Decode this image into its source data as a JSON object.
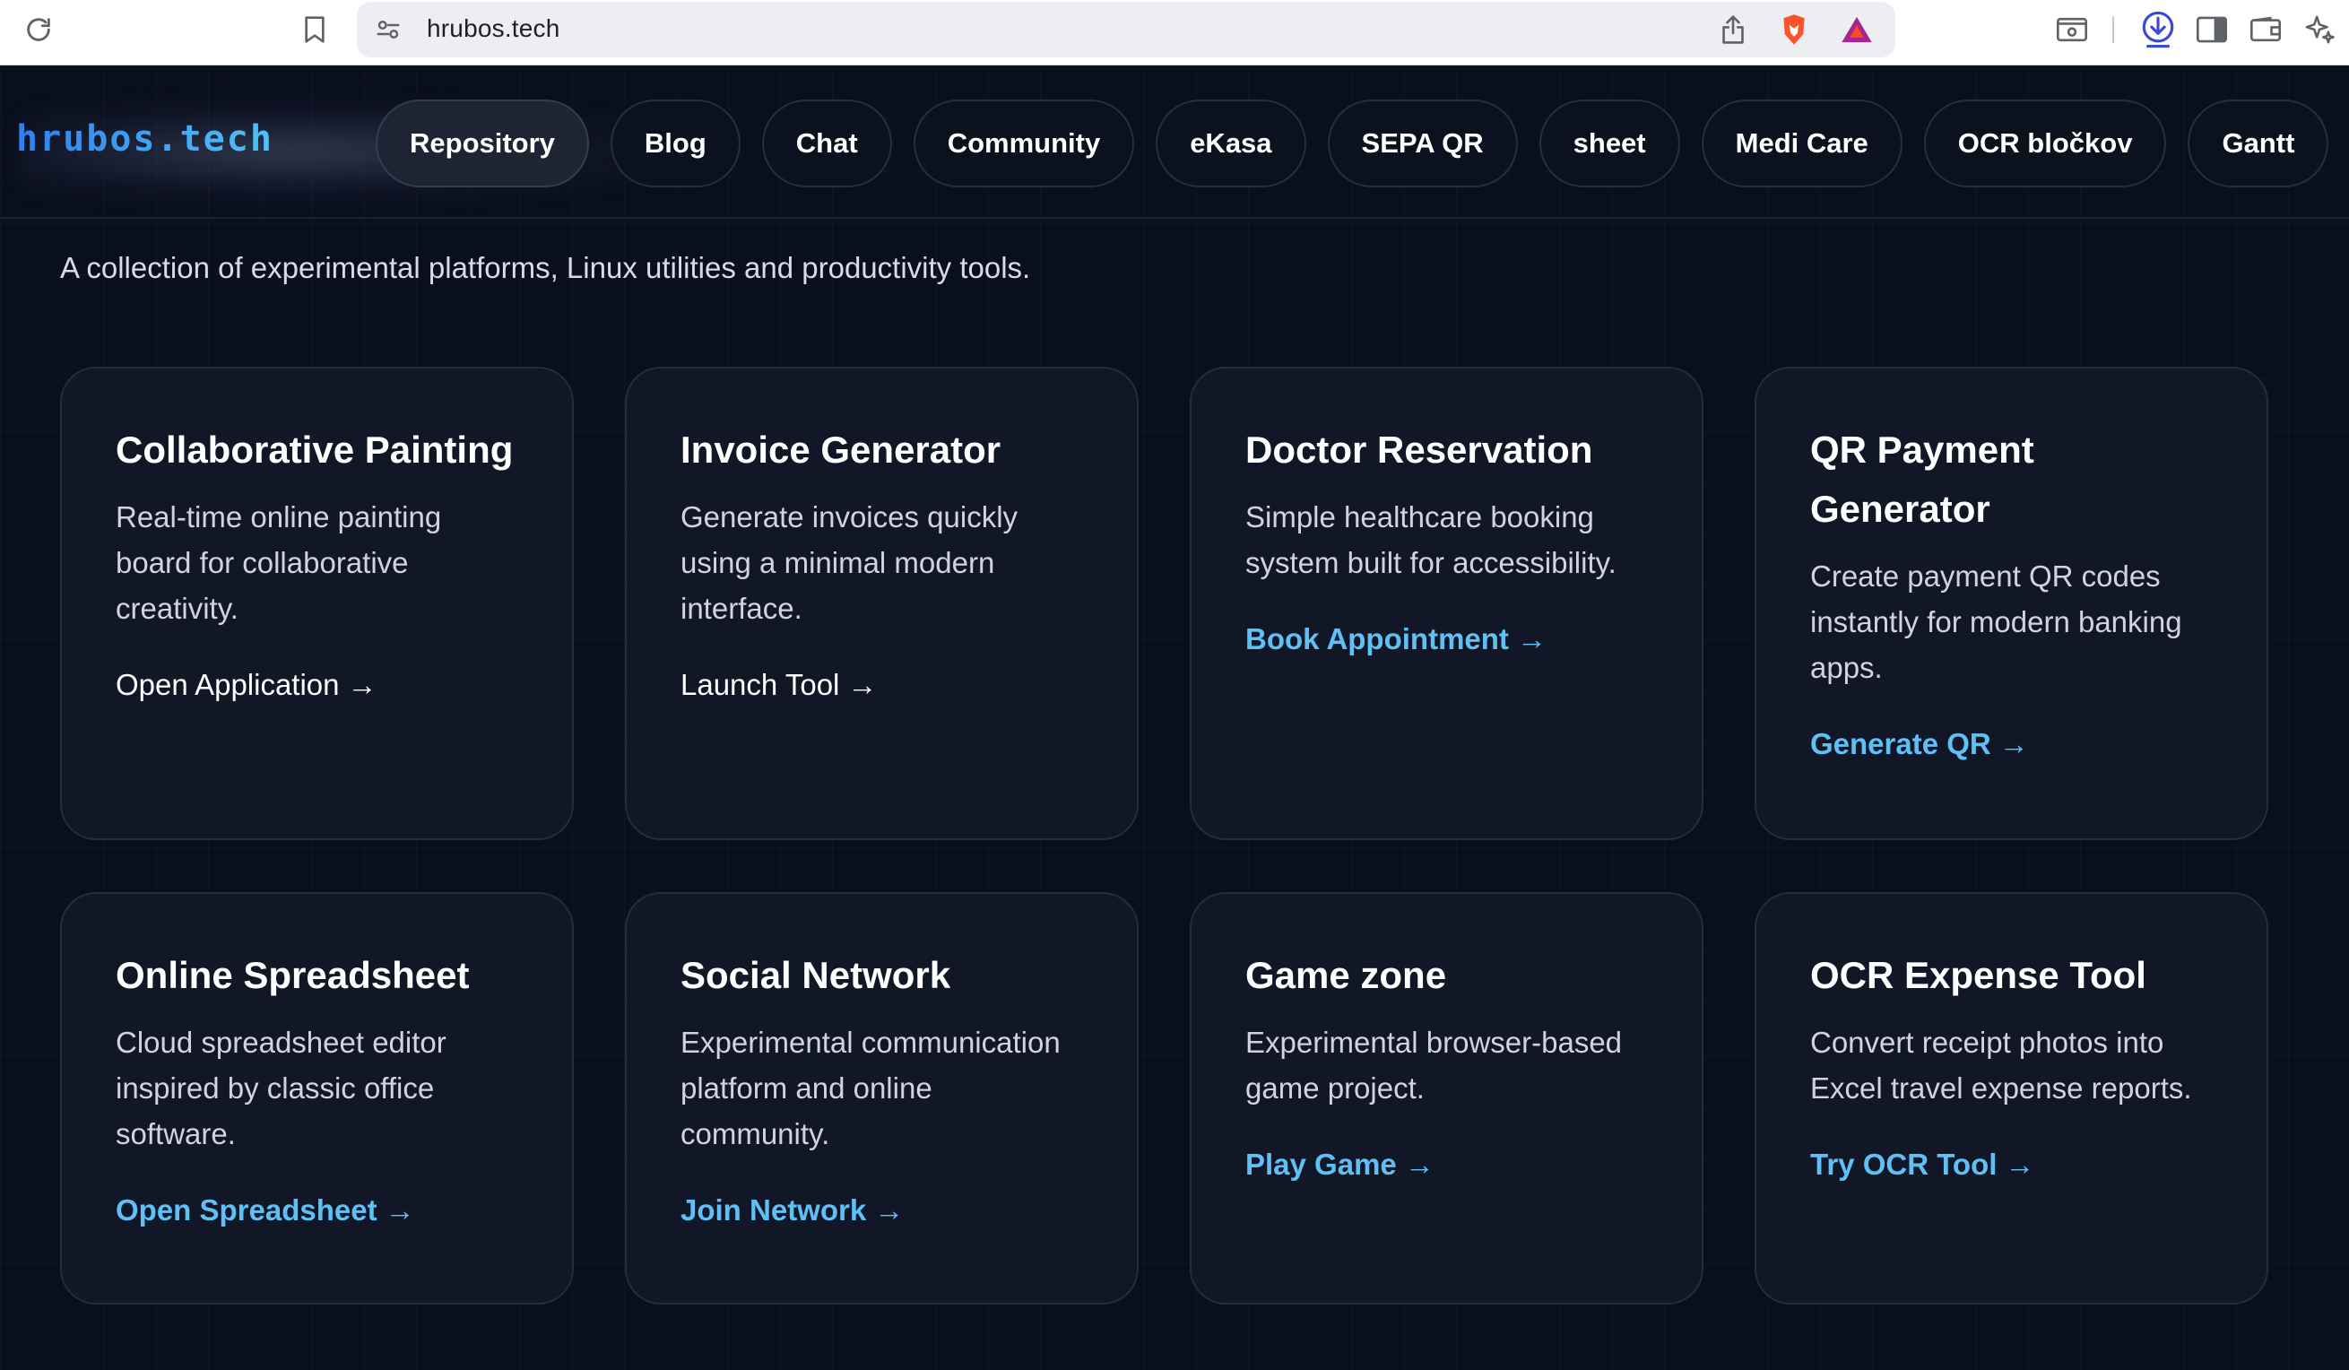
{
  "browser": {
    "url": "hrubos.tech",
    "icons": [
      "reload-icon",
      "bookmark-icon",
      "site-info-icon",
      "share-icon",
      "brave-shield-icon",
      "brave-rewards-icon",
      "screenshot-icon",
      "download-icon",
      "sidebar-toggle-icon",
      "wallet-icon",
      "leo-icon"
    ]
  },
  "header": {
    "logo": "hrubos.tech",
    "nav": [
      {
        "label": "Repository",
        "active": true
      },
      {
        "label": "Blog"
      },
      {
        "label": "Chat"
      },
      {
        "label": "Community"
      },
      {
        "label": "eKasa"
      },
      {
        "label": "SEPA QR"
      },
      {
        "label": "sheet"
      },
      {
        "label": "Medi Care"
      },
      {
        "label": "OCR bločkov"
      },
      {
        "label": "Gantt"
      }
    ]
  },
  "tagline": "A collection of experimental platforms, Linux utilities and productivity tools.",
  "cards": [
    {
      "title": "Collaborative Painting",
      "desc": "Real-time online painting board for collaborative creativity.",
      "link": "Open Application →",
      "link_style": "plain"
    },
    {
      "title": "Invoice Generator",
      "desc": "Generate invoices quickly using a minimal modern interface.",
      "link": "Launch Tool →",
      "link_style": "plain"
    },
    {
      "title": "Doctor Reservation",
      "desc": "Simple healthcare booking system built for accessibility.",
      "link": "Book Appointment →",
      "link_style": "accent"
    },
    {
      "title": "QR Payment Generator",
      "desc": "Create payment QR codes instantly for modern banking apps.",
      "link": "Generate QR →",
      "link_style": "accent"
    },
    {
      "title": "Online Spreadsheet",
      "desc": "Cloud spreadsheet editor inspired by classic office software.",
      "link": "Open Spreadsheet →",
      "link_style": "accent"
    },
    {
      "title": "Social Network",
      "desc": "Experimental communication platform and online community.",
      "link": "Join Network →",
      "link_style": "accent"
    },
    {
      "title": "Game zone",
      "desc": "Experimental browser-based game project.",
      "link": "Play Game →",
      "link_style": "accent"
    },
    {
      "title": "OCR Expense Tool",
      "desc": "Convert receipt photos into Excel travel expense reports.",
      "link": "Try OCR Tool →",
      "link_style": "accent"
    }
  ],
  "colors": {
    "background": "#0a0f1e",
    "card": "#111727",
    "accent_link": "#5fc0f5",
    "logo_start": "#2f7ff0",
    "logo_end": "#4fc3f7"
  }
}
